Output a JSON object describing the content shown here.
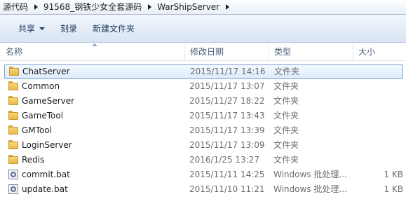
{
  "breadcrumb": {
    "items": [
      "源代码",
      "91568_钢铁少女全套源码",
      "WarShipServer"
    ]
  },
  "toolbar": {
    "share_label": "共享",
    "burn_label": "刻录",
    "new_folder_label": "新建文件夹"
  },
  "columns": {
    "name": "名称",
    "date": "修改日期",
    "type": "类型",
    "size": "大小"
  },
  "files": [
    {
      "name": "ChatServer",
      "date": "2015/11/17 14:16",
      "type": "文件夹",
      "size": "",
      "icon": "folder-icon",
      "selected": true
    },
    {
      "name": "Common",
      "date": "2015/11/17 13:07",
      "type": "文件夹",
      "size": "",
      "icon": "folder-icon"
    },
    {
      "name": "GameServer",
      "date": "2015/11/27 18:22",
      "type": "文件夹",
      "size": "",
      "icon": "folder-icon"
    },
    {
      "name": "GameTool",
      "date": "2015/11/17 13:43",
      "type": "文件夹",
      "size": "",
      "icon": "folder-icon"
    },
    {
      "name": "GMTool",
      "date": "2015/11/17 13:39",
      "type": "文件夹",
      "size": "",
      "icon": "folder-icon"
    },
    {
      "name": "LoginServer",
      "date": "2015/11/17 13:09",
      "type": "文件夹",
      "size": "",
      "icon": "folder-icon"
    },
    {
      "name": "Redis",
      "date": "2016/1/25 13:27",
      "type": "文件夹",
      "size": "",
      "icon": "folder-icon"
    },
    {
      "name": "commit.bat",
      "date": "2015/11/11 14:25",
      "type": "Windows 批处理...",
      "size": "1 KB",
      "icon": "bat-file-icon"
    },
    {
      "name": "update.bat",
      "date": "2015/11/10 11:21",
      "type": "Windows 批处理...",
      "size": "1 KB",
      "icon": "bat-file-icon"
    }
  ],
  "colors": {
    "toolbar_text": "#1e395b",
    "selection_border": "#7da2ce",
    "folder": "#f8d775"
  }
}
